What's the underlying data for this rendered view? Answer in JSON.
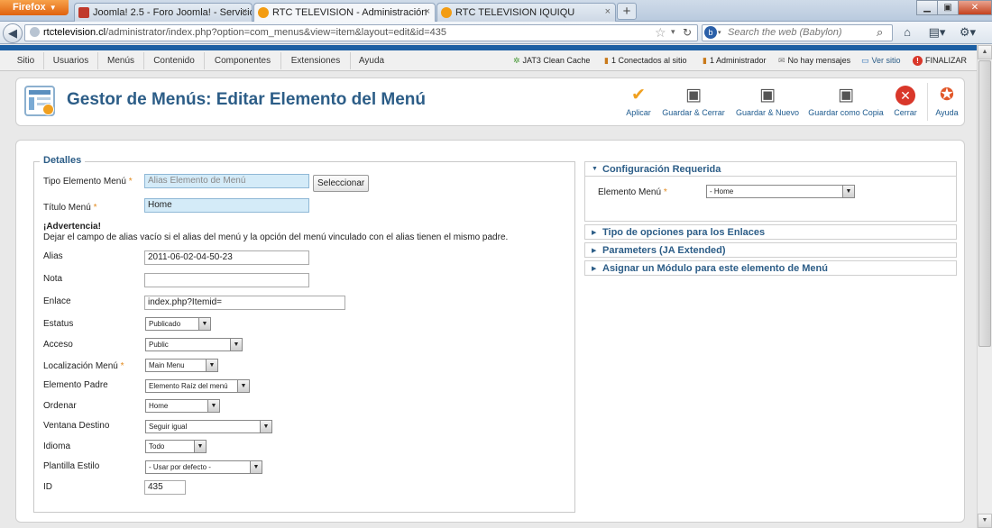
{
  "browser": {
    "menu_button": "Firefox",
    "tabs": [
      {
        "label": "Joomla! 2.5 - Foro Joomla! - Servicios ..."
      },
      {
        "label": "RTC TELEVISION - Administración"
      },
      {
        "label": "RTC TELEVISION IQUIQU"
      }
    ],
    "url_host": "rtctelevision.cl",
    "url_path": "/administrator/index.php?option=com_menus&view=item&layout=edit&id=435",
    "search_placeholder": "Search the web (Babylon)"
  },
  "admin_menu": [
    "Sitio",
    "Usuarios",
    "Menús",
    "Contenido",
    "Componentes",
    "Extensiones",
    "Ayuda"
  ],
  "status": {
    "cache": "JAT3 Clean Cache",
    "online": "1 Conectados al sitio",
    "admins": "1 Administrador",
    "messages": "No hay mensajes",
    "view_site": "Ver sitio",
    "logout": "FINALIZAR"
  },
  "page_title": "Gestor de Menús: Editar Elemento del Menú",
  "toolbar": {
    "apply": "Aplicar",
    "save_close": "Guardar & Cerrar",
    "save_new": "Guardar & Nuevo",
    "save_copy": "Guardar como Copia",
    "close": "Cerrar",
    "help": "Ayuda"
  },
  "details": {
    "legend": "Detalles",
    "type_label": "Tipo Elemento Menú",
    "type_value": "Alias Elemento de Menú",
    "select_button": "Seleccionar",
    "title_label": "Título Menú",
    "title_value": "Home",
    "warning_title": "¡Advertencia!",
    "warning_text": "Dejar el campo de alias vacío si el alias del menú y la opción del menú vinculado con el alias tienen el mismo padre.",
    "alias_label": "Alias",
    "alias_value": "2011-06-02-04-50-23",
    "note_label": "Nota",
    "note_value": "",
    "link_label": "Enlace",
    "link_value": "index.php?Itemid=",
    "status_label": "Estatus",
    "status_value": "Publicado",
    "access_label": "Acceso",
    "access_value": "Public",
    "menu_location_label": "Localización Menú",
    "menu_location_value": "Main Menu",
    "parent_label": "Elemento Padre",
    "parent_value": "Elemento Raíz del menú",
    "order_label": "Ordenar",
    "order_value": "Home",
    "target_label": "Ventana Destino",
    "target_value": "Seguir igual",
    "language_label": "Idioma",
    "language_value": "Todo",
    "template_label": "Plantilla Estilo",
    "template_value": "- Usar por defecto -",
    "id_label": "ID",
    "id_value": "435"
  },
  "right_panels": {
    "required_title": "Configuración Requerida",
    "menu_item_label": "Elemento Menú",
    "menu_item_value": "- Home",
    "link_options": "Tipo de opciones para los Enlaces",
    "parameters": "Parameters (JA Extended)",
    "assign_module": "Asignar un Módulo para este elemento de Menú"
  },
  "required_marker": "*",
  "colors": {
    "accent": "#2c5d87",
    "joomla_bar": "#1c5fa3",
    "highlight_input": "#d4ebf8",
    "close_red": "#d9372a",
    "apply_orange": "#f0a020"
  }
}
